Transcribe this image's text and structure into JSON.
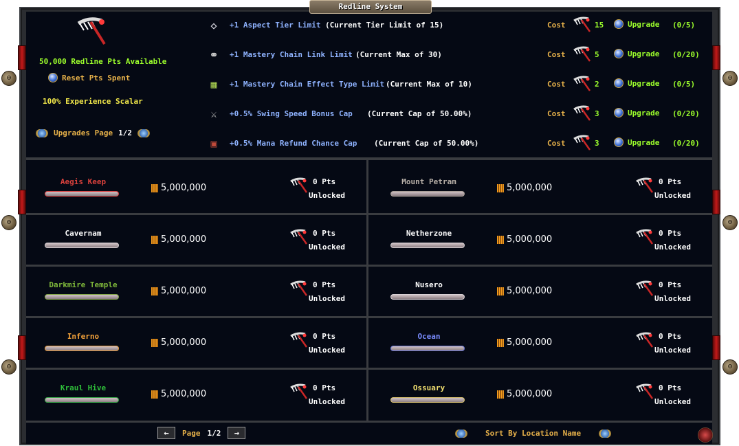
{
  "window": {
    "title": "Redline System"
  },
  "summary": {
    "points_available": "50,000 Redline Pts Available",
    "reset_label": "Reset Pts Spent",
    "experience_scalar": "100% Experience Scalar",
    "page_label": "Upgrades Page",
    "page_value": "1/2"
  },
  "upgrades": [
    {
      "icon": "gem-icon",
      "title": "+1 Aspect Tier Limit",
      "current": "(Current Tier Limit of 15)",
      "cost_label": "Cost",
      "cost": "15",
      "button": "Upgrade",
      "count": "(0/5)"
    },
    {
      "icon": "chain-link-icon",
      "title": "+1 Mastery Chain Link Limit",
      "current": "(Current Max of 30)",
      "cost_label": "Cost",
      "cost": "5",
      "button": "Upgrade",
      "count": "(0/20)"
    },
    {
      "icon": "scroll-icon",
      "title": "+1 Mastery Chain Effect Type Limit",
      "current": "(Current Max of 10)",
      "cost_label": "Cost",
      "cost": "2",
      "button": "Upgrade",
      "count": "(0/5)"
    },
    {
      "icon": "sword-icon",
      "title": "+0.5% Swing Speed Bonus Cap",
      "current": "(Current Cap of 50.00%)",
      "cost_label": "Cost",
      "cost": "3",
      "button": "Upgrade",
      "count": "(0/20)"
    },
    {
      "icon": "mana-book-icon",
      "title": "+0.5% Mana Refund Chance Cap",
      "current": "(Current Cap of 50.00%)",
      "cost_label": "Cost",
      "cost": "3",
      "button": "Upgrade",
      "count": "(0/20)"
    }
  ],
  "locations": [
    {
      "name": "Aegis Keep",
      "name_color": "#d9413c",
      "bar_color": "#d94040",
      "gold": "5,000,000",
      "pts": "0 Pts",
      "status": "Unlocked"
    },
    {
      "name": "Mount Petram",
      "name_color": "#b8b0a8",
      "bar_color": "#a89e96",
      "gold": "5,000,000",
      "pts": "0 Pts",
      "status": "Unlocked"
    },
    {
      "name": "Cavernam",
      "name_color": "#ffffff",
      "bar_color": "#d8d0d4",
      "gold": "5,000,000",
      "pts": "0 Pts",
      "status": "Unlocked"
    },
    {
      "name": "Netherzone",
      "name_color": "#ffffff",
      "bar_color": "#d8d0d4",
      "gold": "5,000,000",
      "pts": "0 Pts",
      "status": "Unlocked"
    },
    {
      "name": "Darkmire Temple",
      "name_color": "#7fb83a",
      "bar_color": "#86a84a",
      "gold": "5,000,000",
      "pts": "0 Pts",
      "status": "Unlocked"
    },
    {
      "name": "Nusero",
      "name_color": "#ffffff",
      "bar_color": "#d8d0d4",
      "gold": "5,000,000",
      "pts": "0 Pts",
      "status": "Unlocked"
    },
    {
      "name": "Inferno",
      "name_color": "#f4a23a",
      "bar_color": "#e89a3c",
      "gold": "5,000,000",
      "pts": "0 Pts",
      "status": "Unlocked"
    },
    {
      "name": "Ocean",
      "name_color": "#7a8cff",
      "bar_color": "#6a78d8",
      "gold": "5,000,000",
      "pts": "0 Pts",
      "status": "Unlocked"
    },
    {
      "name": "Kraul Hive",
      "name_color": "#2fbf3a",
      "bar_color": "#3aa84a",
      "gold": "5,000,000",
      "pts": "0 Pts",
      "status": "Unlocked"
    },
    {
      "name": "Ossuary",
      "name_color": "#f2e070",
      "bar_color": "#d8c070",
      "gold": "5,000,000",
      "pts": "0 Pts",
      "status": "Unlocked"
    }
  ],
  "footer": {
    "page_label": "Page",
    "page_value": "1/2",
    "sort_label": "Sort By Location Name"
  },
  "colors": {
    "accent_green": "#9dff2c",
    "accent_gold": "#e8b24a",
    "blue_text": "#8fb3ff",
    "panel_bg": "#050914"
  }
}
